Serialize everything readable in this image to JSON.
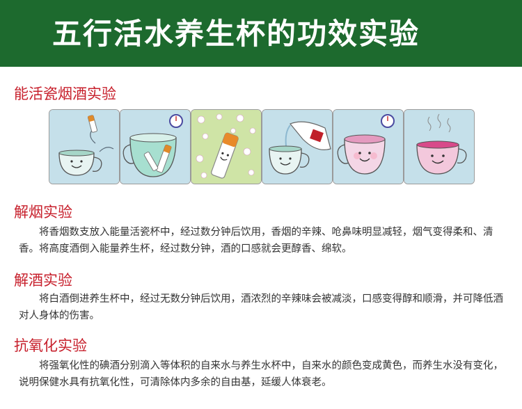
{
  "page": {
    "title": "五行活水养生杯的功效实验"
  },
  "sections": [
    {
      "title": "能活瓷烟酒实验"
    },
    {
      "title": "解烟实验",
      "body": "将香烟数支放入能量活瓷杯中，经过数分钟后饮用，香烟的辛辣、呛鼻味明显减轻，烟气变得柔和、清香。将高度酒倒入能量养生杯，经过数分钟，酒的口感就会更醇香、绵软。"
    },
    {
      "title": "解酒实验",
      "body": "将白酒倒进养生杯中，经过无数分钟后饮用，酒浓烈的辛辣味会被减淡，口感变得醇和顺滑，并可降低酒对人身体的伤害。"
    },
    {
      "title": "抗氧化实验",
      "body": "将强氧化性的碘酒分别滴入等体积的自来水与养生水杯中，自来水的颜色变成黄色，而养生水没有变化，说明保健水具有抗氧化性，可清除体内多余的自由基，延缓人体衰老。"
    }
  ],
  "colors": {
    "banner": "#1d6a2e",
    "section_title": "#c7202c",
    "panel_bg": "#c5e0ea",
    "panel_alt_bg": "#cfe4a6"
  },
  "illustrations": [
    {
      "icon": "cigarette-into-cup-icon"
    },
    {
      "icon": "cigarettes-in-cup-clock-icon"
    },
    {
      "icon": "happy-cigarette-flowers-icon"
    },
    {
      "icon": "liquor-pour-icon"
    },
    {
      "icon": "pink-happy-cup-clock-icon"
    },
    {
      "icon": "steaming-pink-cup-icon"
    }
  ]
}
